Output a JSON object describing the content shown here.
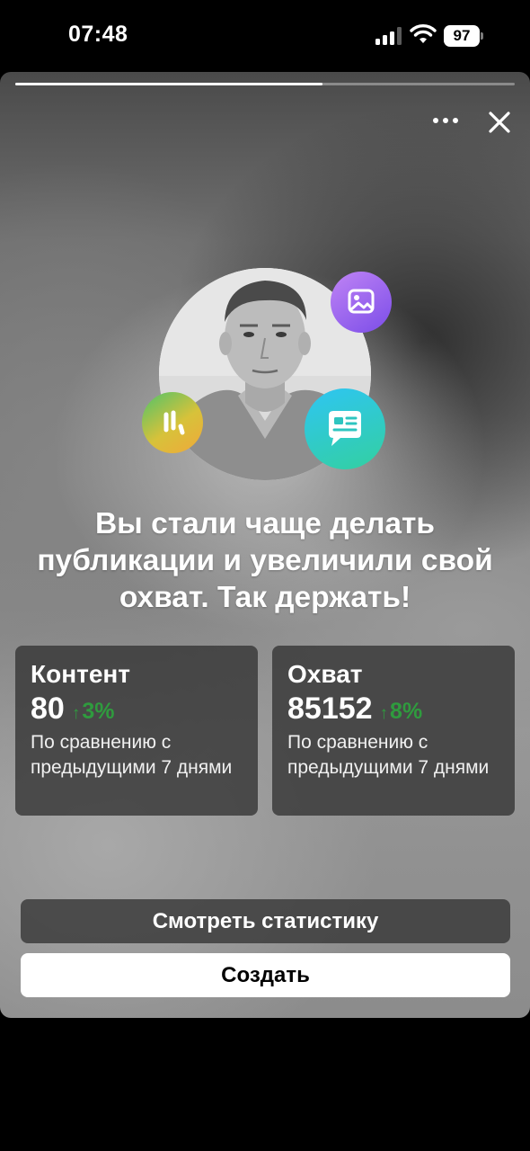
{
  "status_bar": {
    "time": "07:48",
    "battery": "97",
    "icons": [
      "signal-icon",
      "wifi-icon",
      "battery-icon"
    ]
  },
  "story": {
    "progress": 0.615,
    "icons": [
      "more-icon",
      "close-icon",
      "photo-icon",
      "stats-icon",
      "chat-icon"
    ],
    "headline": "Вы стали чаще делать публикации и увеличили свой охват. Так держать!",
    "metrics": [
      {
        "title": "Контент",
        "value": "80",
        "change": "3%",
        "caption": "По сравнению с предыдущими 7 днями"
      },
      {
        "title": "Охват",
        "value": "85152",
        "change": "8%",
        "caption": "По сравнению с предыдущими 7 днями"
      }
    ],
    "buttons": {
      "stats": "Смотреть статистику",
      "create": "Создать"
    }
  },
  "colors": {
    "positive_change": "#2f9b3e",
    "bubble_photo": "#9b63f0",
    "bubble_stats": "#6fc24d",
    "bubble_chat": "#2ec5f3"
  }
}
